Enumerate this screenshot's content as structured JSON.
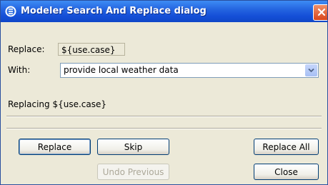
{
  "window": {
    "title": "Modeler Search And Replace dialog",
    "title_bar_color": "#2565e0",
    "close_button_color": "#d9461c"
  },
  "form": {
    "replace_label": "Replace:",
    "replace_value": "${use.case}",
    "with_label": "With:",
    "with_value": "provide local weather data",
    "status_text": "Replacing ${use.case}"
  },
  "buttons": {
    "replace": "Replace",
    "skip": "Skip",
    "replace_all": "Replace All",
    "undo_previous": "Undo Previous",
    "close": "Close"
  },
  "icons": {
    "app": "app-icon",
    "close": "close-icon",
    "dropdown": "chevron-down-icon"
  }
}
